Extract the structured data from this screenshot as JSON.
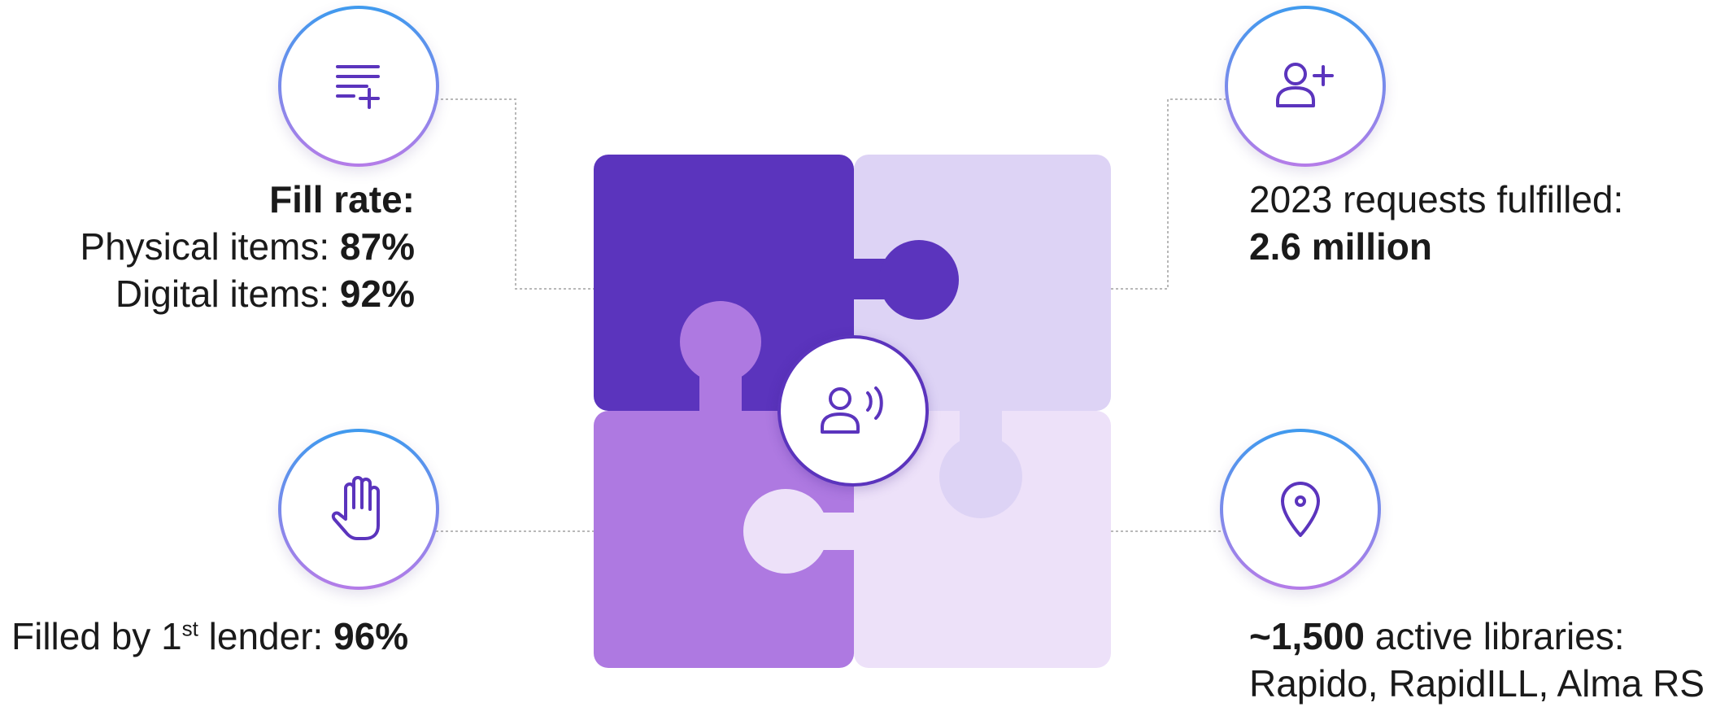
{
  "colors": {
    "piece_top_left": "#5b34bd",
    "piece_top_right": "#ddd3f5",
    "piece_bottom_left": "#ae79e1",
    "piece_bottom_right": "#ede1f9",
    "icon_stroke": "#5b34bd",
    "connector": "#b8b8b8",
    "ring_gradient_top": "#3f9aee",
    "ring_gradient_bottom": "#b57ce8"
  },
  "icons": {
    "top_left": "list-add-icon",
    "top_right": "user-add-icon",
    "bottom_left": "raised-hand-icon",
    "bottom_right": "location-pin-icon",
    "center": "user-broadcast-icon"
  },
  "stats": {
    "fill_rate": {
      "heading": "Fill rate:",
      "physical_label": "Physical items: ",
      "physical_value": "87%",
      "digital_label": "Digital items: ",
      "digital_value": "92%"
    },
    "requests": {
      "label": "2023 requests fulfilled:",
      "value": "2.6 million"
    },
    "first_lender": {
      "label_pre": "Filled by 1",
      "label_sup": "st",
      "label_post": " lender: ",
      "value": "96%"
    },
    "libraries": {
      "value": "~1,500",
      "label": " active libraries:",
      "systems": "Rapido, RapidILL, Alma RS"
    }
  }
}
